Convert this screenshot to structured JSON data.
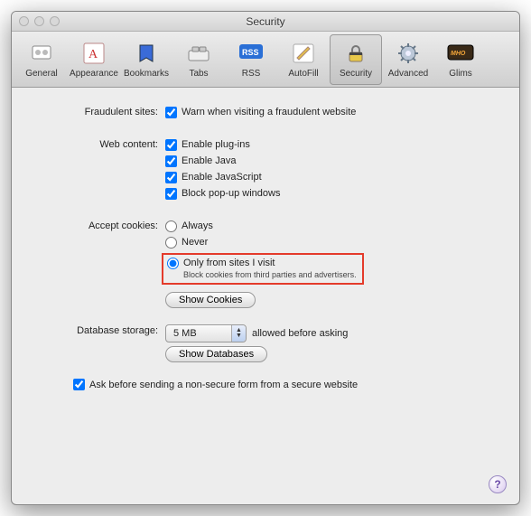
{
  "window": {
    "title": "Security"
  },
  "toolbar": {
    "items": [
      {
        "label": "General"
      },
      {
        "label": "Appearance"
      },
      {
        "label": "Bookmarks"
      },
      {
        "label": "Tabs"
      },
      {
        "label": "RSS"
      },
      {
        "label": "AutoFill"
      },
      {
        "label": "Security"
      },
      {
        "label": "Advanced"
      },
      {
        "label": "Glims"
      }
    ]
  },
  "sections": {
    "fraud": {
      "label": "Fraudulent sites:",
      "warn": "Warn when visiting a fraudulent website"
    },
    "webcontent": {
      "label": "Web content:",
      "plugins": "Enable plug-ins",
      "java": "Enable Java",
      "js": "Enable JavaScript",
      "popups": "Block pop-up windows"
    },
    "cookies": {
      "label": "Accept cookies:",
      "always": "Always",
      "never": "Never",
      "only": "Only from sites I visit",
      "only_sub": "Block cookies from third parties and advertisers.",
      "show_btn": "Show Cookies"
    },
    "db": {
      "label": "Database storage:",
      "value": "5 MB",
      "suffix": "allowed before asking",
      "show_btn": "Show Databases"
    },
    "secure": {
      "label": "Ask before sending a non-secure form from a secure website"
    }
  },
  "help": {
    "label": "?"
  }
}
